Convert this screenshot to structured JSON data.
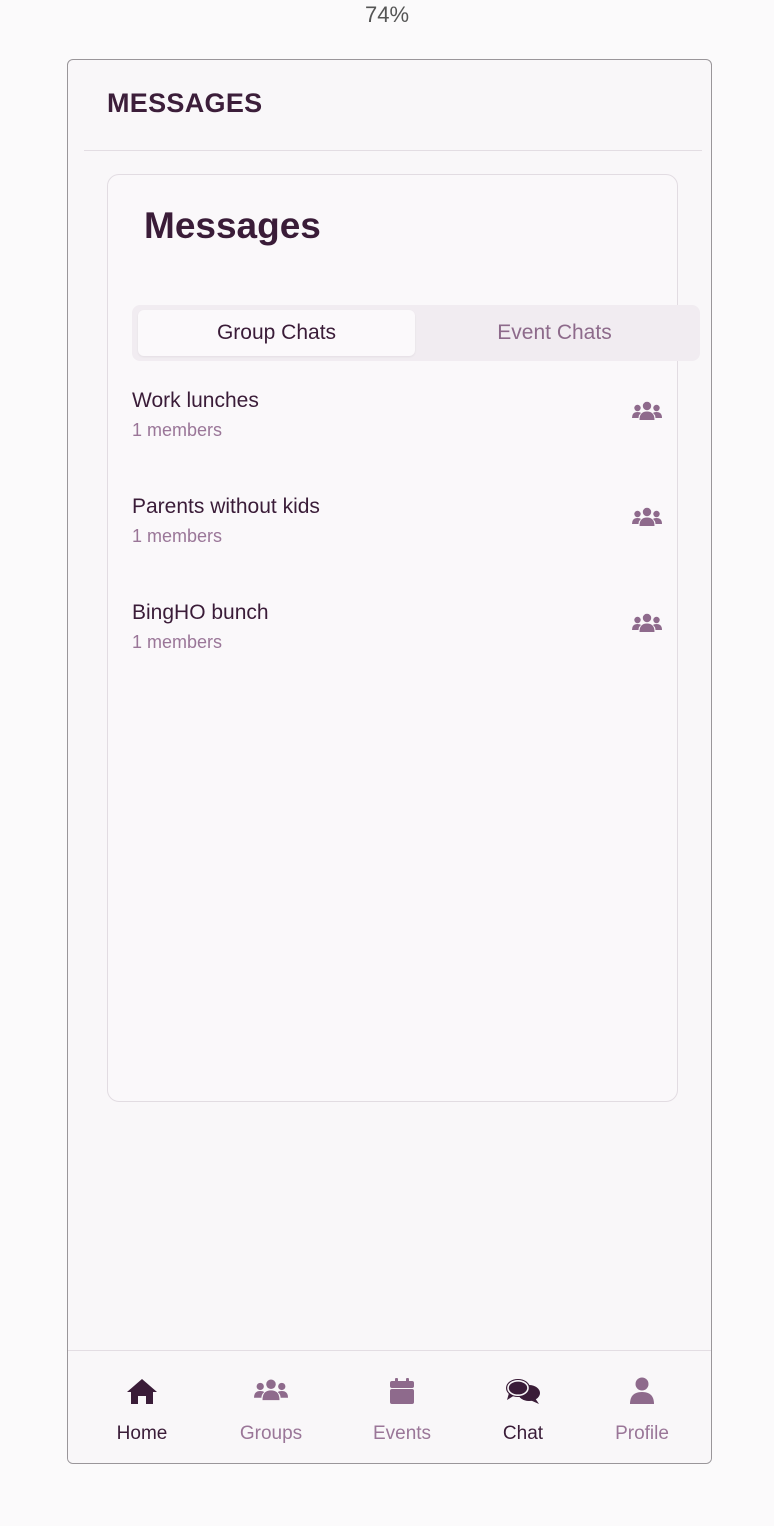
{
  "zoom_level": "74%",
  "header": {
    "title": "MESSAGES"
  },
  "card": {
    "title": "Messages"
  },
  "tabs": [
    {
      "label": "Group Chats",
      "active": true
    },
    {
      "label": "Event Chats",
      "active": false
    }
  ],
  "chats": [
    {
      "name": "Work lunches",
      "members": "1 members",
      "icon": "users-icon"
    },
    {
      "name": "Parents without kids",
      "members": "1 members",
      "icon": "users-icon"
    },
    {
      "name": "BingHO bunch",
      "members": "1 members",
      "icon": "users-icon"
    }
  ],
  "nav": {
    "items": [
      {
        "label": "Home",
        "icon": "home-icon"
      },
      {
        "label": "Groups",
        "icon": "users-icon"
      },
      {
        "label": "Events",
        "icon": "calendar-icon"
      },
      {
        "label": "Chat",
        "icon": "chat-icon"
      },
      {
        "label": "Profile",
        "icon": "user-icon"
      }
    ]
  },
  "colors": {
    "primary_dark": "#3a1c38",
    "muted": "#9a7698",
    "icon_muted": "#8e6a8c",
    "background": "#f9f7f9"
  }
}
